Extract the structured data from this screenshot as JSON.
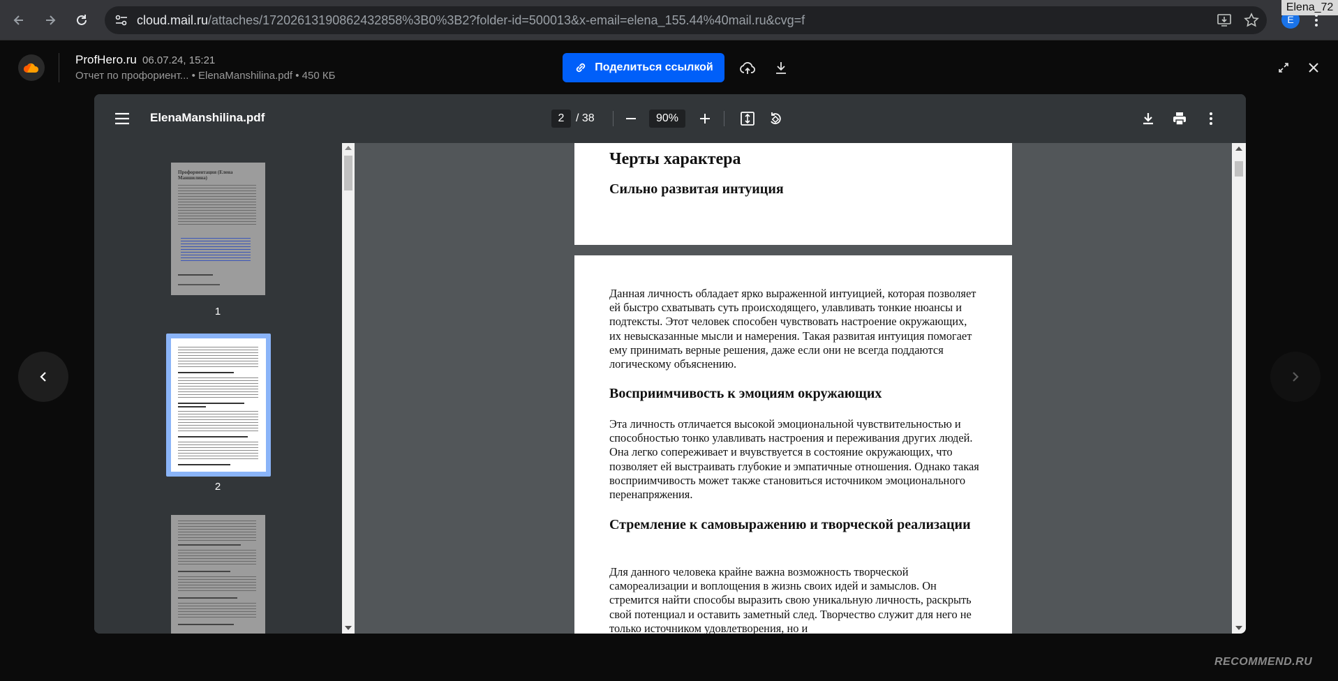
{
  "browser": {
    "url_host": "cloud.mail.ru",
    "url_rest": "/attaches/17202613190862432858%3B0%3B2?folder-id=500013&x-email=elena_155.44%40mail.ru&cvg=f",
    "profile_initial": "E",
    "profile_tag": "Elena_72"
  },
  "topbar": {
    "sender": "ProfHero.ru",
    "date": "06.07.24, 15:21",
    "file_meta": "Отчет по профориент... • ElenaManshilina.pdf • 450 КБ",
    "share_label": "Поделиться ссылкой",
    "accent": "#005ff9"
  },
  "pdf": {
    "title": "ElenaManshilina.pdf",
    "current_page": "2",
    "total_pages": "/ 38",
    "zoom": "90%",
    "thumbnails": [
      {
        "label": "1",
        "title": "Профориентация (Елена Маншилина)",
        "selected": false
      },
      {
        "label": "2",
        "selected": true
      },
      {
        "label": "3",
        "selected": false
      }
    ],
    "page1": {
      "heading": "Черты характера",
      "subheading": "Сильно развитая интуиция"
    },
    "page2": {
      "p1": "Данная личность обладает ярко выраженной интуицией, которая позволяет ей быстро схватывать суть происходящего, улавливать тонкие нюансы и подтексты. Этот человек способен чувствовать настроение окружающих, их невысказанные мысли и намерения. Такая развитая интуиция помогает ему принимать верные решения, даже если они не всегда поддаются логическому объяснению.",
      "h2": "Восприимчивость к эмоциям окружающих",
      "p2": "Эта личность отличается высокой эмоциональной чувствительностью и способностью тонко улавливать настроения и переживания других людей. Она легко сопереживает и вчувствуется в состояние окружающих, что позволяет ей выстраивать глубокие и эмпатичные отношения. Однако такая восприимчивость может также становиться источником эмоционального перенапряжения.",
      "h3": "Стремление к самовыражению и творческой реализации",
      "p3": "Для данного человека крайне важна возможность творческой самореализации и воплощения в жизнь своих идей и замыслов. Он стремится найти способы выразить свою уникальную личность, раскрыть свой потенциал и оставить заметный след. Творчество служит для него не только источником удовлетворения, но и"
    }
  },
  "watermark": "RECOMMEND.RU"
}
